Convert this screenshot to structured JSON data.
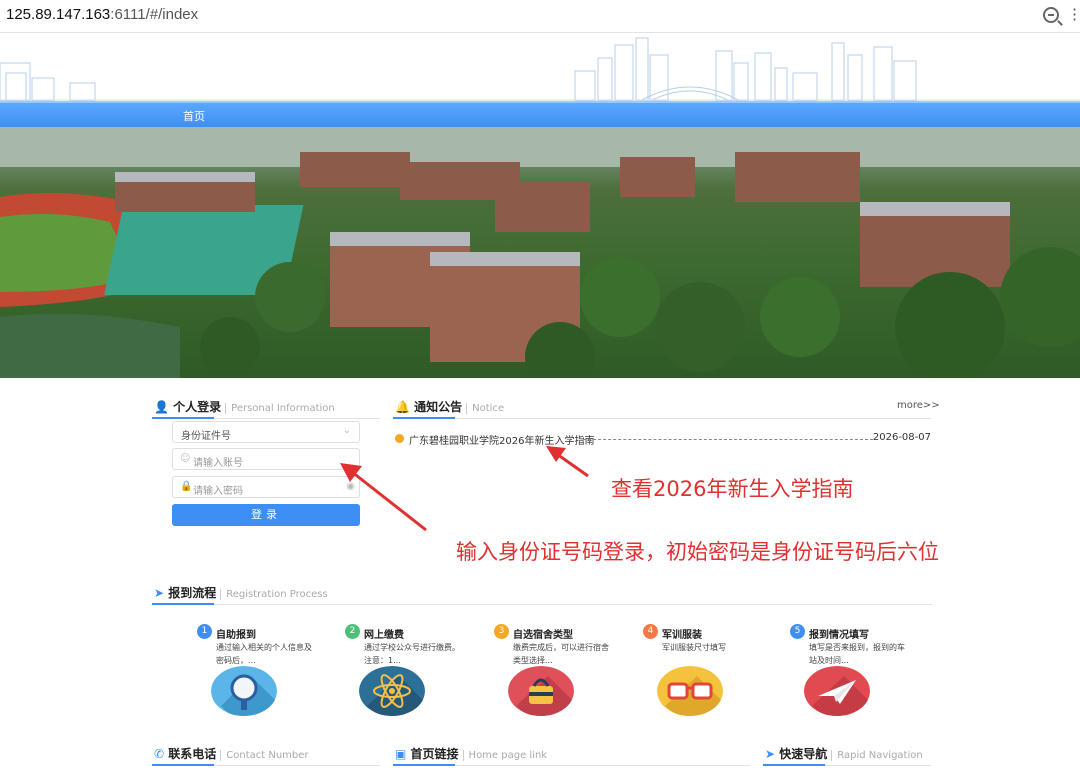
{
  "browser": {
    "url_host": "125.89.147.163",
    "url_rest": ":6111/#/index"
  },
  "nav": {
    "home": "首页"
  },
  "login": {
    "title": "个人登录",
    "title_en": "Personal Information",
    "id_type": "身份证件号",
    "account_placeholder": "请输入账号",
    "password_placeholder": "请输入密码",
    "submit": "登录"
  },
  "notice": {
    "title": "通知公告",
    "title_en": "Notice",
    "more": "more>>",
    "items": [
      {
        "text": "广东碧桂园职业学院2026年新生入学指南",
        "date": "2026-08-07"
      }
    ]
  },
  "annotations": {
    "notice_hint": "查看2026年新生入学指南",
    "login_hint": "输入身份证号码登录，初始密码是身份证号码后六位"
  },
  "process": {
    "title": "报到流程",
    "title_en": "Registration Process",
    "steps": [
      {
        "num": "1",
        "name": "自助报到",
        "desc": "通过输入相关的个人信息及密码后，...",
        "color": "#3e8ff2"
      },
      {
        "num": "2",
        "name": "网上缴费",
        "desc": "通过学校公众号进行缴费。注意：1...",
        "color": "#4cc07a"
      },
      {
        "num": "3",
        "name": "自选宿舍类型",
        "desc": "缴费完成后，可以进行宿舍类型选择...",
        "color": "#f5a623"
      },
      {
        "num": "4",
        "name": "军训服装",
        "desc": "军训服装尺寸填写",
        "color": "#f07a4a"
      },
      {
        "num": "5",
        "name": "报到情况填写",
        "desc": "填写是否来报到，报到的车站及时间...",
        "color": "#3e8ff2"
      }
    ]
  },
  "footer": {
    "contact": "联系电话",
    "contact_en": "Contact Number",
    "links": "首页链接",
    "links_en": "Home page link",
    "quick": "快速导航",
    "quick_en": "Rapid Navigation"
  }
}
